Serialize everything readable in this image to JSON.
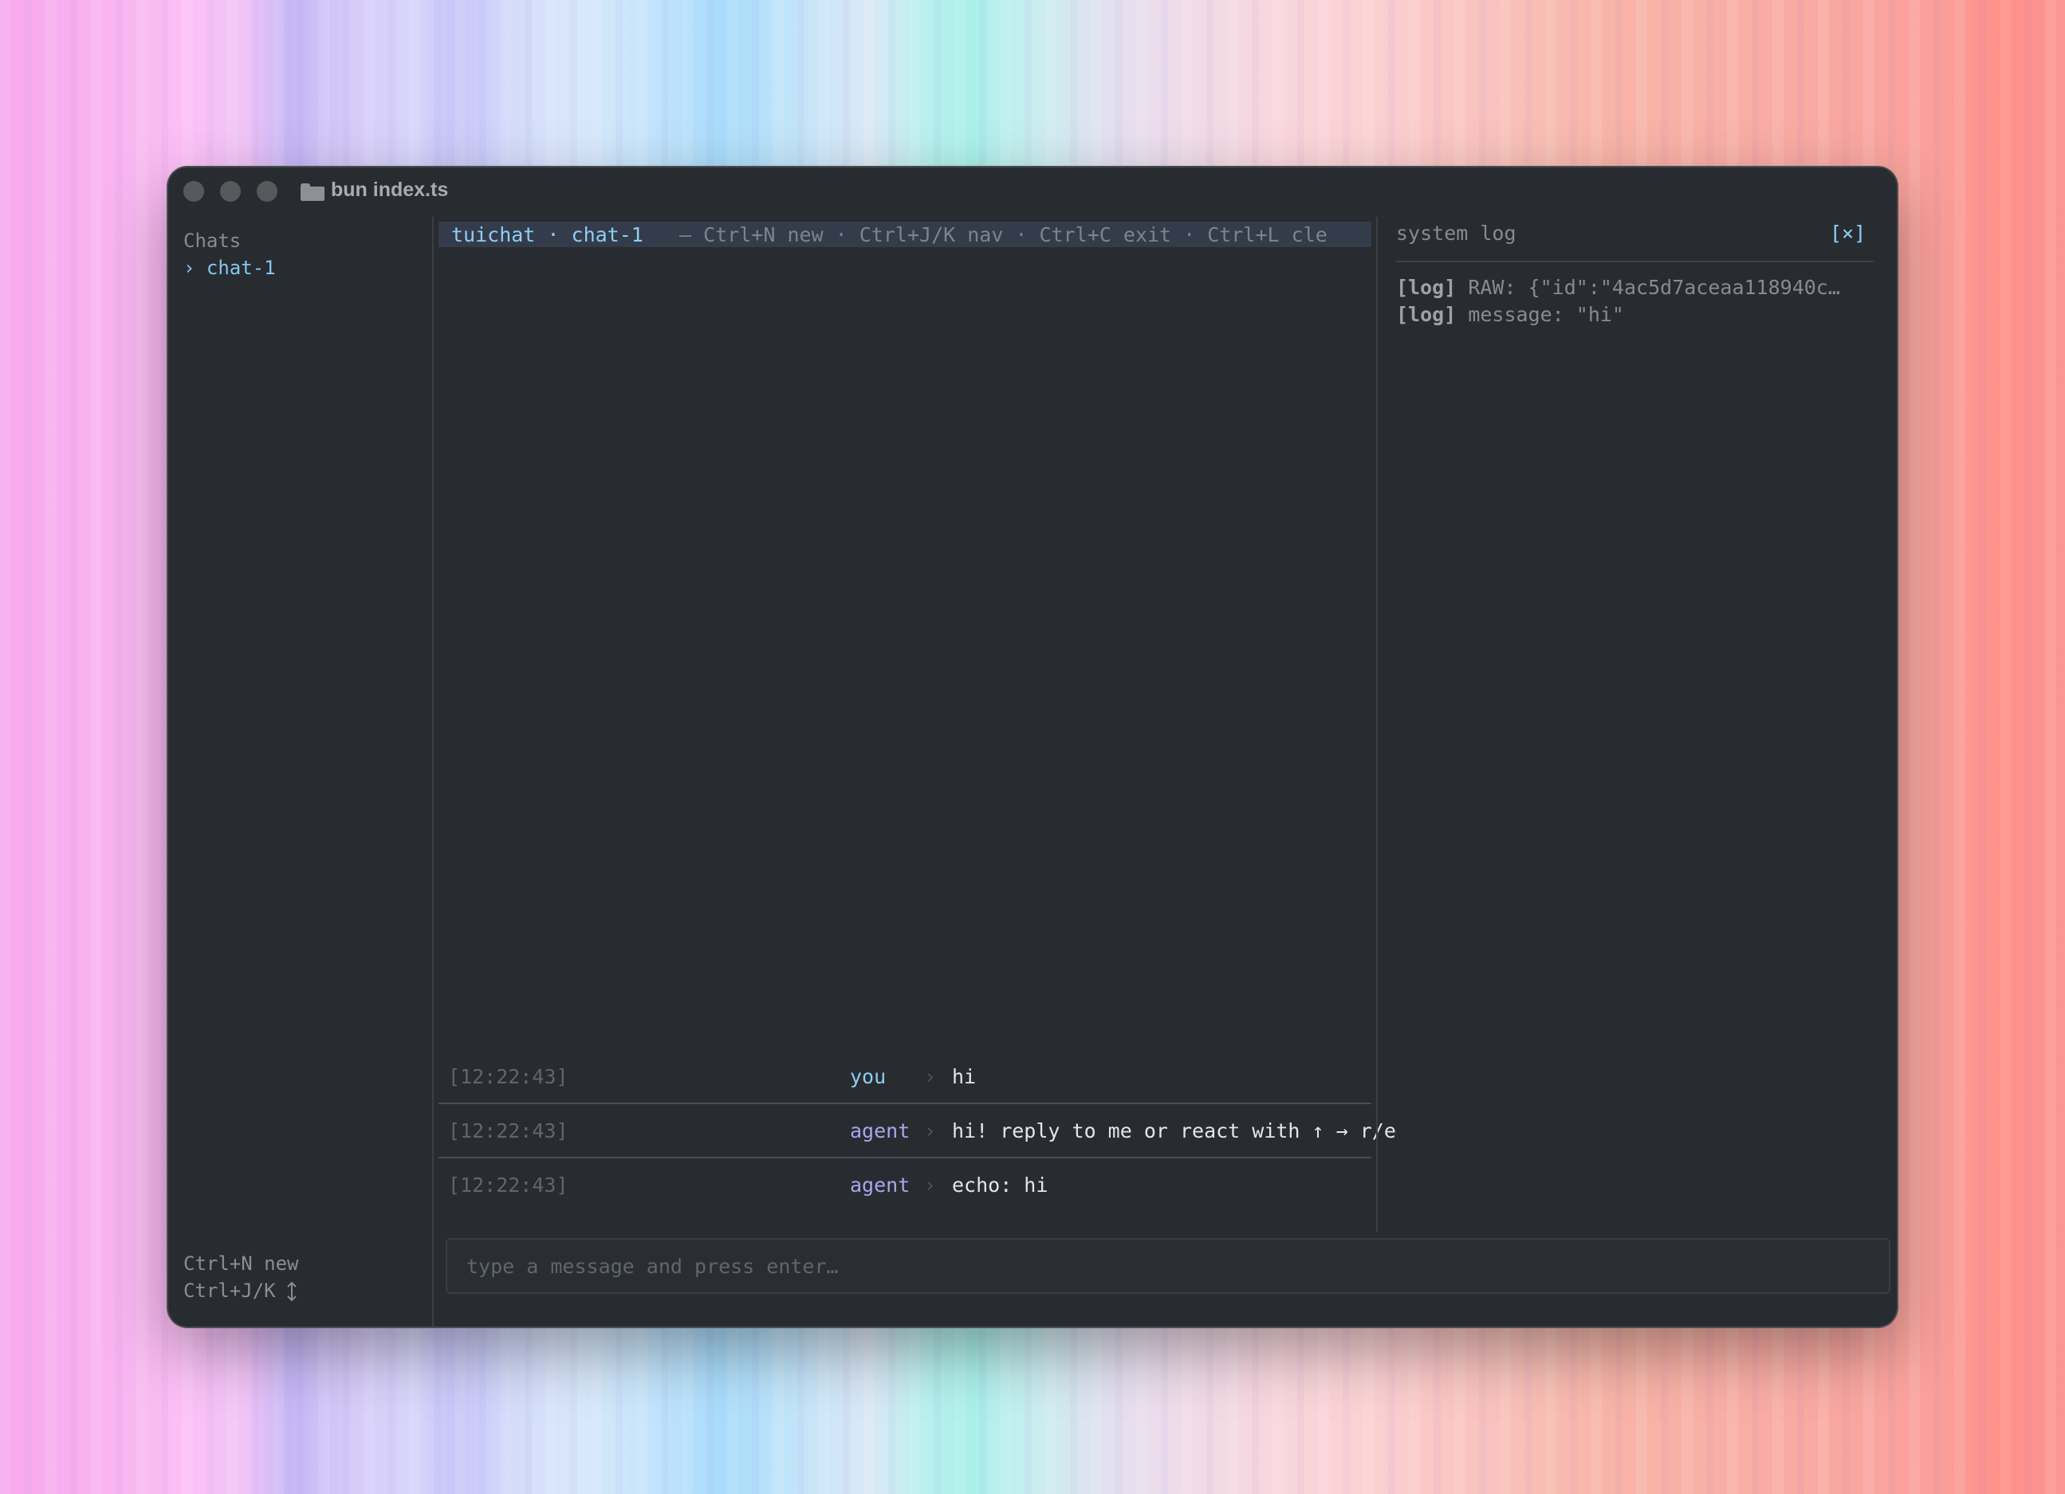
{
  "window": {
    "title": "bun index.ts"
  },
  "sidebar": {
    "heading": "Chats",
    "items": [
      {
        "label": "› chat-1"
      }
    ],
    "footer": {
      "new_hint": "Ctrl+N new",
      "nav_hint": "Ctrl+J/K"
    }
  },
  "chat": {
    "header": {
      "app_and_chat": "tuichat · chat-1",
      "hint": "— Ctrl+N new · Ctrl+J/K nav · Ctrl+C exit · Ctrl+L cle"
    },
    "messages": [
      {
        "time": "[12:22:43]",
        "sender": "you",
        "separator": "›",
        "text": "hi"
      },
      {
        "time": "[12:22:43]",
        "sender": "agent",
        "separator": "›",
        "text": "hi! reply to me or react with ↑ → r/e"
      },
      {
        "time": "[12:22:43]",
        "sender": "agent",
        "separator": "›",
        "text": "echo: hi"
      }
    ]
  },
  "system_log": {
    "title": "system log",
    "close_label": "[×]",
    "entries": [
      {
        "tag": "[log]",
        "text": " RAW: {\"id\":\"4ac5d7aceaa118940c…"
      },
      {
        "tag": "[log]",
        "text": " message: \"hi\""
      }
    ]
  },
  "input": {
    "placeholder": "type a message and press enter…",
    "value": ""
  },
  "colors": {
    "window_bg": "#282c30",
    "accent_cyan": "#8fcdf4",
    "agent_purple": "#a9a6f1",
    "header_bg": "#343c4b"
  }
}
